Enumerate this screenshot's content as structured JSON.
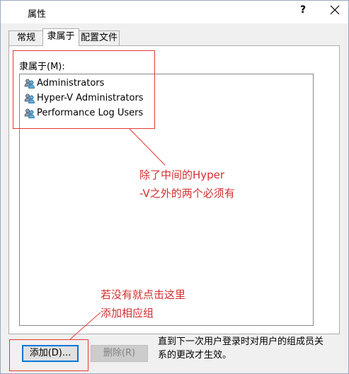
{
  "window": {
    "title": "属性",
    "help_label": "?"
  },
  "tabs": [
    {
      "label": "常规"
    },
    {
      "label": "隶属于"
    },
    {
      "label": "配置文件"
    }
  ],
  "member_of": {
    "label": "隶属于(M):",
    "items": [
      {
        "label": "Administrators",
        "icon": "group-icon"
      },
      {
        "label": "Hyper-V Administrators",
        "icon": "group-icon"
      },
      {
        "label": "Performance Log Users",
        "icon": "group-icon"
      }
    ]
  },
  "buttons": {
    "add_label": "添加(D)...",
    "remove_label": "删除(R)"
  },
  "note": "直到下一次用户登录时对用户的组成员关系的更改才生效。",
  "annotations": {
    "top_line1": "除了中间的Hyper",
    "top_line2": "-V之外的两个必须有",
    "bottom_line1": "若没有就点击这里",
    "bottom_line2": "添加相应组",
    "color": "#e53935"
  },
  "colors": {
    "accent": "#0078d7",
    "panel_bg": "#ffffff",
    "window_bg": "#f0f0f0"
  }
}
